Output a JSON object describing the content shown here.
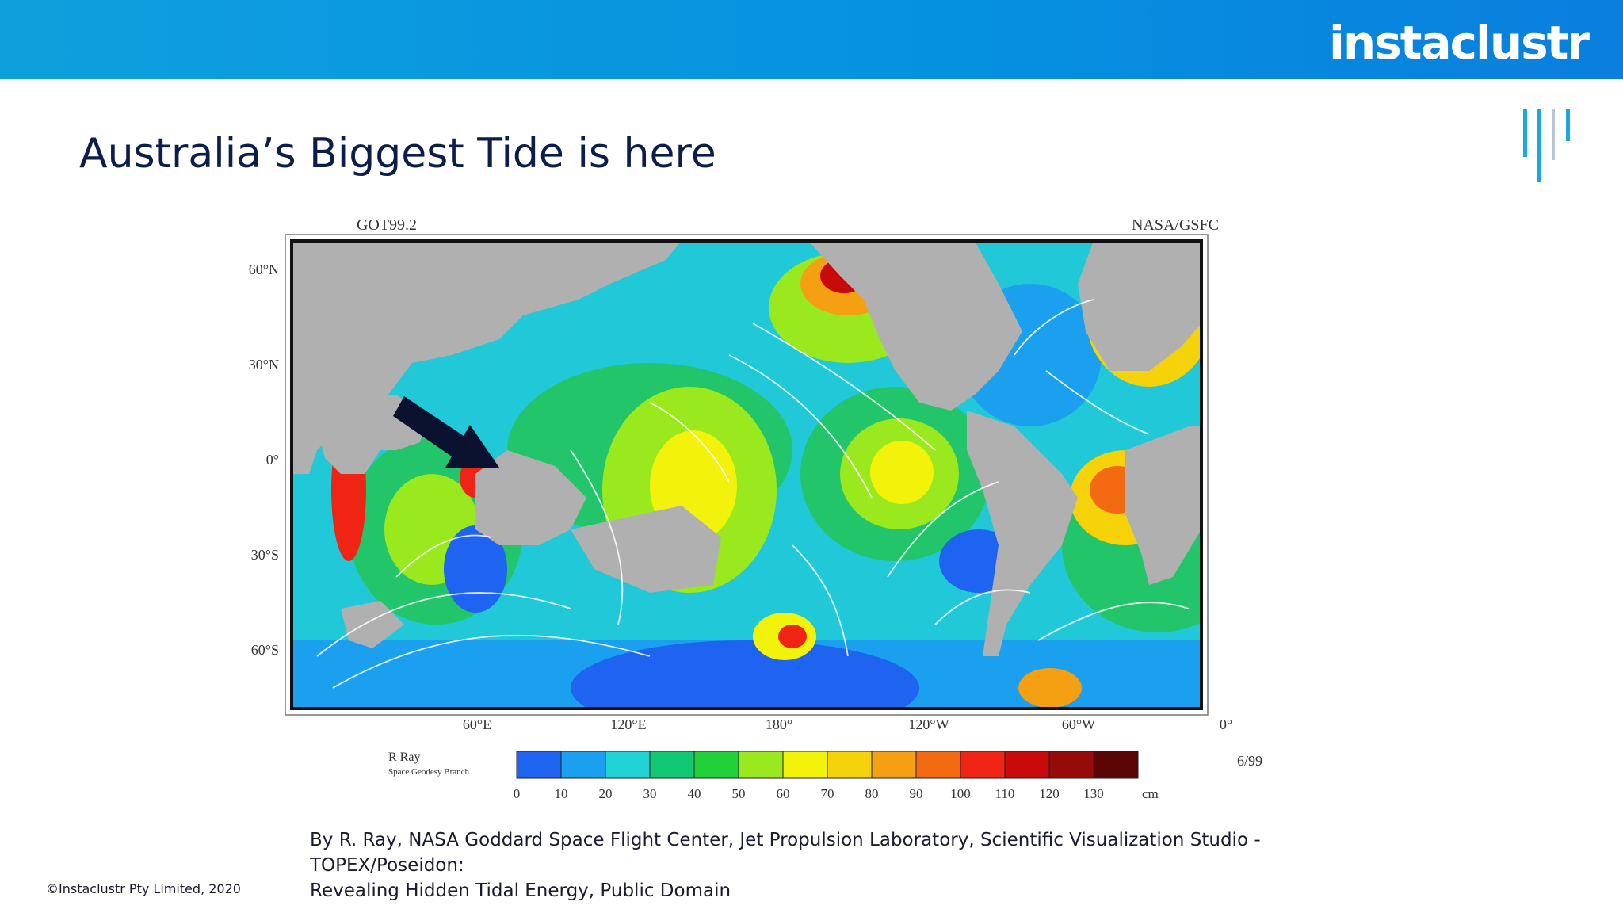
{
  "header": {
    "logo_text": "instaclustr"
  },
  "slide": {
    "title": "Australia’s Biggest Tide is here",
    "caption_line1": "By R. Ray, NASA Goddard Space Flight Center, Jet Propulsion Laboratory, Scientific Visualization Studio - TOPEX/Poseidon:",
    "caption_line2": "Revealing Hidden Tidal Energy, Public Domain",
    "footer": "©Instaclustr Pty Limited, 2020"
  },
  "map": {
    "model_label": "GOT99.2",
    "source_label": "NASA/GSFC",
    "author": "R Ray",
    "author_dept": "Space Geodesy Branch",
    "date": "6/99",
    "lat_labels": [
      "60°N",
      "30°N",
      "0°",
      "30°S",
      "60°S"
    ],
    "lon_labels": [
      "60°E",
      "120°E",
      "180°",
      "120°W",
      "60°W",
      "0°"
    ],
    "legend_ticks": [
      "0",
      "10",
      "20",
      "30",
      "40",
      "50",
      "60",
      "70",
      "80",
      "90",
      "100",
      "110",
      "120",
      "130"
    ],
    "legend_unit": "cm",
    "legend_colors": [
      "#1e64f0",
      "#1aa0ee",
      "#22d3d6",
      "#10c872",
      "#22d03a",
      "#9ae81e",
      "#f2f20a",
      "#f6d20a",
      "#f4a012",
      "#f46a12",
      "#f02414",
      "#c80a0a",
      "#960a0a",
      "#5a0505"
    ],
    "annotation": "arrow pointing to northwest Australia"
  }
}
